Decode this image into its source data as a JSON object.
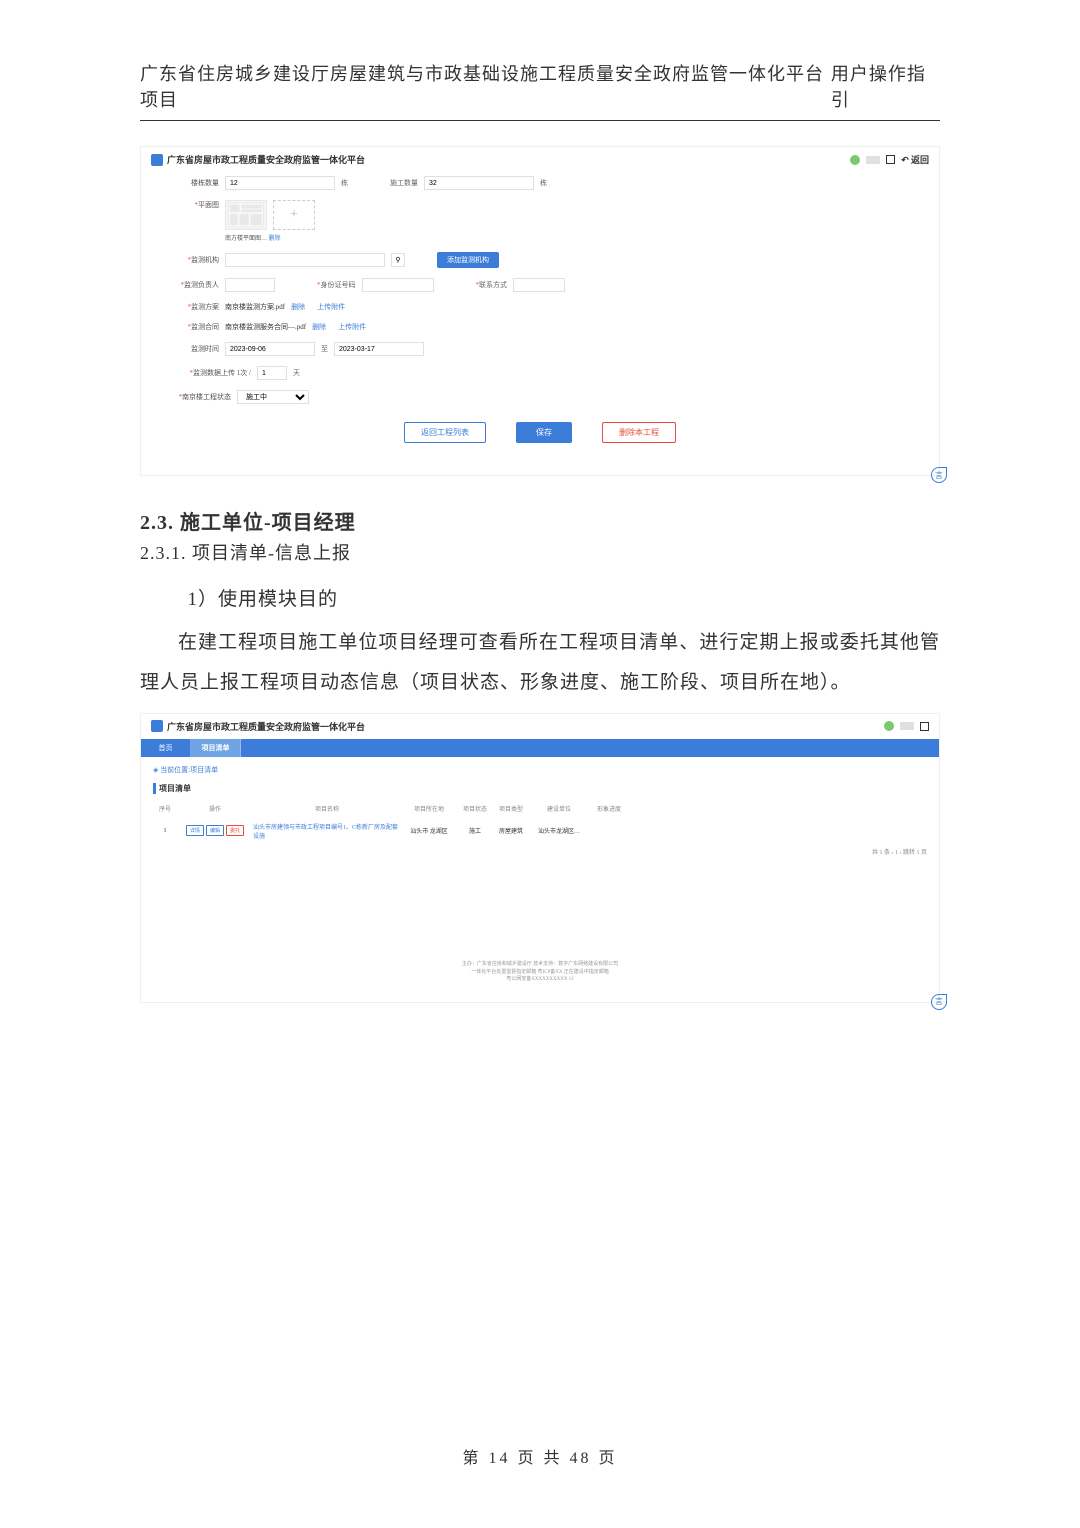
{
  "header": {
    "left": "广东省住房城乡建设厅房屋建筑与市政基础设施工程质量安全政府监管一体化平台项目",
    "right": "用户操作指引"
  },
  "ss1": {
    "title": "广东省房屋市政工程质量安全政府监管一体化平台",
    "back": "返回",
    "row_lou": {
      "label": "楼栋数量",
      "val": "12",
      "unit": "栋",
      "label2": "施工数量",
      "val2": "32",
      "unit2": "栋"
    },
    "plan": {
      "label": "平面图",
      "caption": "南方楼平面图…",
      "caption_act": "删除"
    },
    "monitor_org": {
      "label": "监测机构",
      "btn": "添加监测机构"
    },
    "monitor_person": {
      "label": "监测负责人",
      "id_label": "身份证号码",
      "contact_label": "联系方式"
    },
    "monitor_plan": {
      "label": "监测方案",
      "file": "南京楼监测方案.pdf",
      "del": "删除",
      "upload": "上传附件"
    },
    "monitor_contract": {
      "label": "监测合同",
      "file": "南京楼监测服务合同—.pdf",
      "del": "删除",
      "upload": "上传附件"
    },
    "monitor_time": {
      "label": "监测时间",
      "start": "2023-09-06",
      "sep": "至",
      "end": "2023-03-17"
    },
    "monitor_freq": {
      "label": "监测数据上传 1次 /",
      "val": "1",
      "unit": "天"
    },
    "proj_status": {
      "label": "南京楼工程状态",
      "val": "施工中"
    },
    "btns": {
      "back": "返回工程列表",
      "save": "保存",
      "delete": "删除本工程"
    }
  },
  "doc": {
    "h2": "2.3.  施工单位-项目经理",
    "h3": "2.3.1.  项目清单-信息上报",
    "p1": "1）使用模块目的",
    "p2": "在建工程项目施工单位项目经理可查看所在工程项目清单、进行定期上报或委托其他管理人员上报工程项目动态信息（项目状态、形象进度、施工阶段、项目所在地）。"
  },
  "ss2": {
    "title": "广东省房屋市政工程质量安全政府监管一体化平台",
    "tab1": "首页",
    "tab2": "项目清单",
    "breadcrumb": "当前位置:项目清单",
    "section": "项目清单",
    "head": {
      "seq": "序号",
      "ops": "操作",
      "name": "项目名称",
      "city": "项目所在地",
      "status": "项目状态",
      "type": "项目类型",
      "unit": "建设单位",
      "spot": "形象进度"
    },
    "row": {
      "seq": "1",
      "op1": "详情",
      "op2": "编辑",
      "op3": "委托",
      "name": "汕头市房建领与市政工程项目编号1、C栋新厂房及配套设施",
      "city": "汕头市 龙湖区",
      "status": "施工",
      "type": "房屋建筑",
      "unit": "汕头市龙湖区…",
      "spot": ""
    },
    "pagination": "共 1 条    ‹    1    ›     跳转    1    页",
    "footer1": "主办：广东省住房和城乡建设厅    技术支持：数字广东网络建设有限公司",
    "footer2": "一体化平台处置监督指定邮箱    粤ICP备XX 正在建设中指定邮箱",
    "footer3": "粤公网安备XXXXXXXXXX 12"
  },
  "foot": "第  14  页  共  48  页",
  "corner": "言"
}
